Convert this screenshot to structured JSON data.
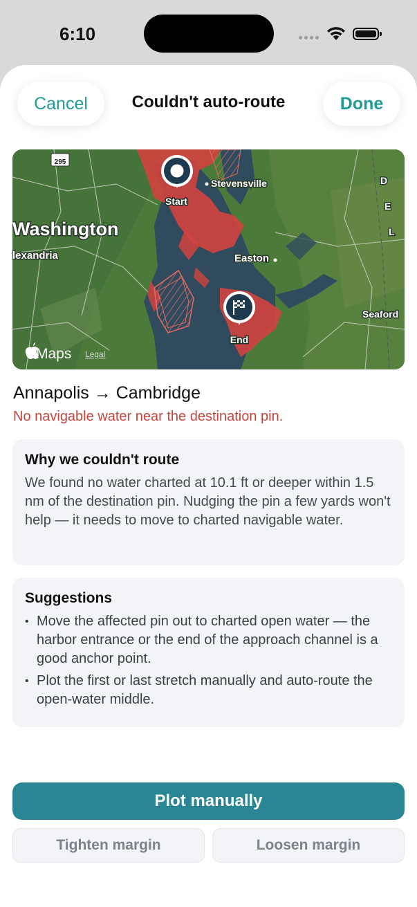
{
  "status_bar": {
    "time": "6:10"
  },
  "nav": {
    "cancel_label": "Cancel",
    "title": "Couldn't auto-route",
    "done_label": "Done"
  },
  "map": {
    "route_shield": "295",
    "labels": {
      "washington": "Washington",
      "alexandria": "lexandria",
      "stevensville": "Stevensville",
      "easton": "Easton",
      "seaford": "Seaford",
      "delaware": [
        "D",
        "E",
        "L"
      ]
    },
    "start_label": "Start",
    "end_label": "End",
    "attribution": "Maps",
    "legal_label": "Legal",
    "colors": {
      "water": "#2f4b5d",
      "land": "#4b7a3a",
      "hazard": "#d2433f"
    }
  },
  "route": {
    "title": "Annapolis → Cambridge",
    "error": "No navigable water near the destination pin."
  },
  "why_card": {
    "heading": "Why we couldn't route",
    "body": "We found no water charted at 10.1 ft or deeper within 1.5 nm of the destination pin. Nudging the pin a few yards won't help — it needs to move to charted navigable water."
  },
  "suggestions_card": {
    "heading": "Suggestions",
    "items": [
      "Move the affected pin out to charted open water — the harbor entrance or the end of the approach channel is a good anchor point.",
      "Plot the first or last stretch manually and auto-route the open-water middle."
    ]
  },
  "actions": {
    "primary_label": "Plot manually",
    "tighten_label": "Tighten margin",
    "loosen_label": "Loosen margin"
  },
  "accent_color": "#1f9c93",
  "error_color": "#c4443c",
  "primary_button_color": "#2a8595"
}
